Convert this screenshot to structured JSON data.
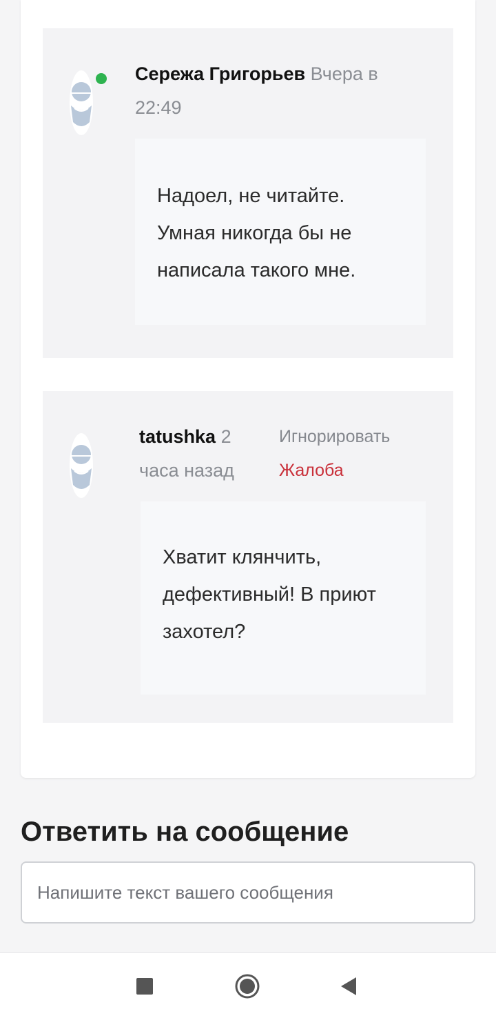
{
  "comments": [
    {
      "author": "Сережа Григорьев",
      "time_line1": "Вчера в",
      "time_line2": "22:49",
      "online": true,
      "text_lines": [
        "Надоел, не читайте.",
        "Умная никогда бы не",
        "написала такого мне."
      ]
    },
    {
      "author": "tatushka",
      "time_line1": "2",
      "time_line2": "часа назад",
      "online": false,
      "actions": {
        "ignore": "Игнорировать",
        "report": "Жалоба"
      },
      "text_lines": [
        "Хватит клянчить,",
        "дефективный! В приют",
        "захотел?"
      ]
    }
  ],
  "reply": {
    "title": "Ответить на сообщение",
    "placeholder": "Напишите текст вашего сообщения"
  },
  "colors": {
    "online": "#2eb350",
    "report": "#c9303a",
    "avatar": "#b9c8da"
  },
  "nav": {
    "icons": [
      "recent-apps-icon",
      "home-icon",
      "back-icon"
    ]
  }
}
